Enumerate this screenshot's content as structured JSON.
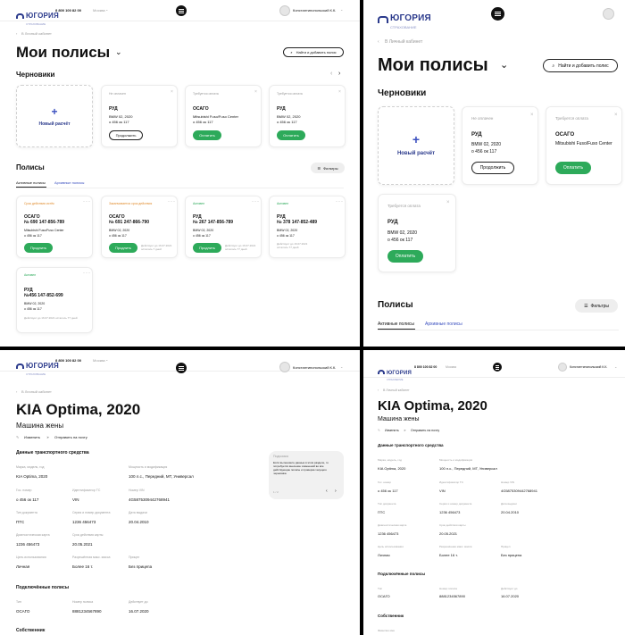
{
  "header": {
    "logo": "ЮГОРИЯ",
    "logo_sub": "СТРАХОВАНИЕ",
    "phone": "8 800 100 82 00",
    "city": "Москва",
    "user": "Константинопольский К.К."
  },
  "policies_page": {
    "breadcrumb": "В Личный кабинет",
    "title": "Мои полисы",
    "find_button": "Найти и добавить полис",
    "drafts_title": "Черновики",
    "new_calc": "Новый расчёт",
    "drafts": [
      {
        "status": "Не оплачен",
        "type": "РУД",
        "car": "BMW 02, 2020",
        "plate": "о 456 ок 117",
        "action": "Продолжить",
        "action_style": "outline"
      },
      {
        "status": "Требуется оплата",
        "type": "ОСАГО",
        "car": "Mitsubishi Fuso/Fuso Center",
        "plate": "о 456 ок 117",
        "action": "Оплатить",
        "action_style": "green"
      },
      {
        "status": "Требуется оплата",
        "type": "РУД",
        "car": "BMW 02, 2020",
        "plate": "о 456 ок 117",
        "action": "Оплатить",
        "action_style": "green"
      }
    ],
    "policies_title": "Полисы",
    "filters": "Фильтры",
    "tabs": [
      "Активные полисы",
      "Архивные полисы"
    ],
    "policies": [
      {
        "status": "Срок действия истёк",
        "status_color": "#e08a2a",
        "type": "ОСАГО",
        "number": "№ 690 147-856-789",
        "car": "Mitsubishi Fuso/Fuso Center",
        "plate": "о 456 ок 117",
        "action": "Продлить",
        "note": ""
      },
      {
        "status": "Заканчивается срок действия",
        "status_color": "#e08a2a",
        "type": "ОСАГО",
        "number": "№ 691 247-866-790",
        "car": "BMW 02, 2020",
        "plate": "о 456 ок 117",
        "action": "Продлить",
        "note": "Действует до 16.07.2021 осталось 7 дней"
      },
      {
        "status": "Активен",
        "status_color": "#2daa5a",
        "type": "РУД",
        "number": "№ 267 147-856-789",
        "car": "BMW 02, 2020",
        "plate": "о 456 ок 117",
        "action": "Продлить",
        "note": "Действует до 16.07.2021 осталось 77 дней"
      },
      {
        "status": "Активен",
        "status_color": "#2daa5a",
        "type": "РУД",
        "number": "№ 378 147-852-489",
        "car": "BMW 02, 2020",
        "plate": "о 456 ок 117",
        "action": "",
        "note": "Действует до 16.07.2021 осталось 77 дней"
      },
      {
        "status": "Активен",
        "status_color": "#2daa5a",
        "type": "РУД",
        "number": "№456 147-852-699",
        "car": "BMW 02, 2020",
        "plate": "о 456 ок 117",
        "action": "",
        "note": "Действует до 16.07.2021 осталось 77 дней"
      }
    ]
  },
  "car_page": {
    "breadcrumb": "В Личный кабинет",
    "title": "KIA Optima, 2020",
    "subtitle": "Машина жены",
    "edit": "Изменить",
    "send": "Отправить на почту",
    "vehicle_section": "Данные транспортного средства",
    "fields": [
      {
        "label": "Марка, модель, год",
        "value": "KIA Optima, 2020"
      },
      {
        "label": "Мощность и модификация",
        "value": "100 л.с., Передний, MT, Универсал"
      },
      {
        "label": "Гос. номер",
        "value": "о 456 ок 117"
      },
      {
        "label": "Идентификатор ТС",
        "value": "VIN"
      },
      {
        "label": "Номер VIN",
        "value": "4G5875309442768941"
      },
      {
        "label": "Тип документа",
        "value": "ПТС"
      },
      {
        "label": "Серия и номер документа",
        "value": "1236 456473"
      },
      {
        "label": "Дата выдачи",
        "value": "20.04.2010"
      },
      {
        "label": "Диагностическая карта",
        "value": "1236 456473"
      },
      {
        "label": "Срок действия карты",
        "value": "20.05.2021"
      },
      {
        "label": "Цель использования",
        "value": "Личная"
      },
      {
        "label": "Разрешённая макс. масса",
        "value": "Более 16 т."
      },
      {
        "label": "Прицеп",
        "value": "Без прицепа"
      }
    ],
    "linked_section": "Подключённые полисы",
    "linked_headers": [
      "Тип",
      "Номер полиса",
      "Действует до"
    ],
    "linked_values": [
      "ОСАГО",
      "8881234567890",
      "16.07.2020"
    ],
    "owner_section": "Собственник",
    "owner_label": "Фамилия имя",
    "tooltip_title": "Подсказка",
    "tooltip_text": "Если вы меняете данные в этом разделе, то потребуется внесение изменений во все действующие полисы и проверка текущего черновика",
    "tooltip_pager": "1 / 2"
  }
}
